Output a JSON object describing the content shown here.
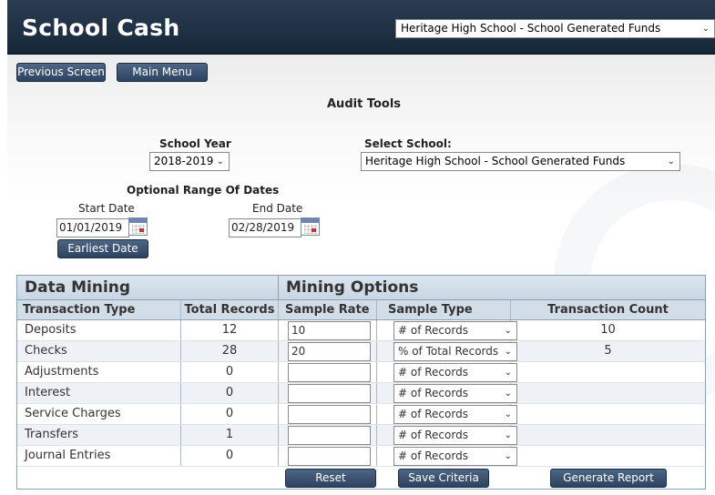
{
  "header": {
    "title": "School Cash",
    "school_select": "Heritage High School - School Generated Funds"
  },
  "nav": {
    "previous_label": "Previous Screen",
    "main_menu_label": "Main Menu"
  },
  "page_title": "Audit Tools",
  "filters": {
    "school_year_label": "School Year",
    "school_year_value": "2018-2019",
    "select_school_label": "Select School:",
    "select_school_value": "Heritage High School - School Generated Funds",
    "date_range_label": "Optional Range Of Dates",
    "start_date_label": "Start Date",
    "start_date_value": "01/01/2019",
    "end_date_label": "End Date",
    "end_date_value": "02/28/2019",
    "earliest_date_label": "Earliest Date"
  },
  "grid": {
    "section_data_mining": "Data Mining",
    "section_mining_options": "Mining Options",
    "columns": [
      "Transaction Type",
      "Total Records",
      "Sample Rate",
      "Sample Type",
      "Transaction Count"
    ],
    "rows": [
      {
        "type": "Deposits",
        "total": "12",
        "rate": "10",
        "sample_type": "# of Records",
        "count": "10"
      },
      {
        "type": "Checks",
        "total": "28",
        "rate": "20",
        "sample_type": "% of Total Records",
        "count": "5"
      },
      {
        "type": "Adjustments",
        "total": "0",
        "rate": "",
        "sample_type": "# of Records",
        "count": ""
      },
      {
        "type": "Interest",
        "total": "0",
        "rate": "",
        "sample_type": "# of Records",
        "count": ""
      },
      {
        "type": "Service Charges",
        "total": "0",
        "rate": "",
        "sample_type": "# of Records",
        "count": ""
      },
      {
        "type": "Transfers",
        "total": "1",
        "rate": "",
        "sample_type": "# of Records",
        "count": ""
      },
      {
        "type": "Journal Entries",
        "total": "0",
        "rate": "",
        "sample_type": "# of Records",
        "count": ""
      }
    ]
  },
  "actions": {
    "reset_label": "Reset",
    "save_label": "Save Criteria",
    "generate_label": "Generate Report"
  },
  "icons": {
    "dropdown": "chevron-down-icon",
    "calendar": "calendar-icon"
  }
}
